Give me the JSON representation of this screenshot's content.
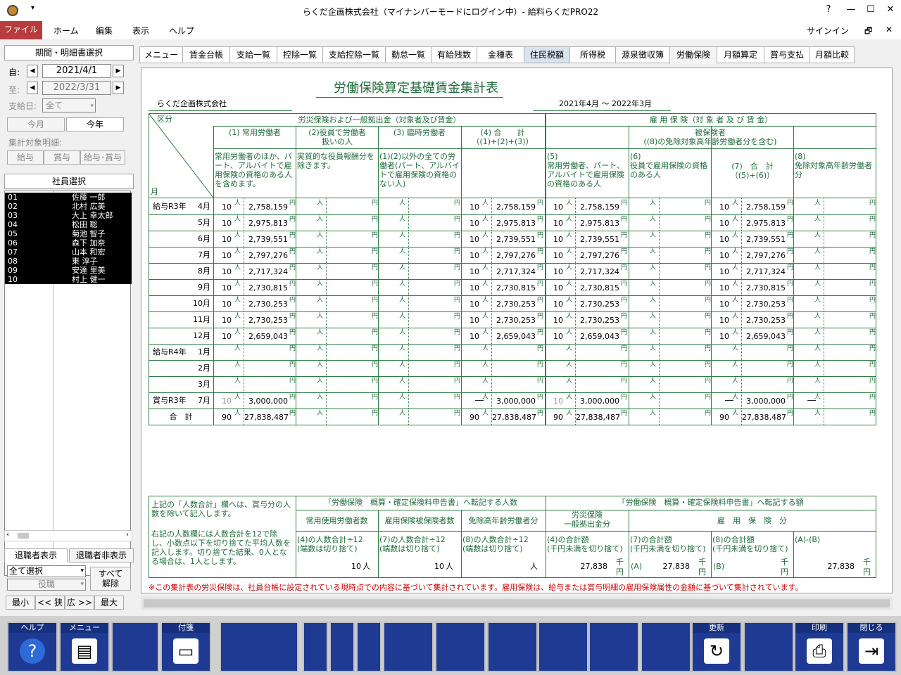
{
  "window": {
    "title": "らくだ企画株式会社（マイナンバーモードにログイン中）- 給料らくだPRO22",
    "signin": "サインイン"
  },
  "menu": [
    "ファイル",
    "ホーム",
    "編集",
    "表示",
    "ヘルプ"
  ],
  "left": {
    "header": "期間・明細書選択",
    "from_label": "自:",
    "from_date": "2021/4/1",
    "to_label": "至:",
    "to_date": "2022/3/31",
    "payday_label": "支給日:",
    "payday_value": "全て",
    "btn_thismonth": "今月",
    "btn_thisyear": "今年",
    "target_label": "集計対象明細:",
    "btn_salary": "給与",
    "btn_bonus": "賞与",
    "btn_both": "給与･賞与",
    "emp_header": "社員選択",
    "employees": [
      {
        "code": "01",
        "name": "佐藤 一郎"
      },
      {
        "code": "02",
        "name": "北村 広美"
      },
      {
        "code": "03",
        "name": "大上 幸太郎"
      },
      {
        "code": "04",
        "name": "松田 聡"
      },
      {
        "code": "05",
        "name": "菊池 智子"
      },
      {
        "code": "06",
        "name": "森下 加奈"
      },
      {
        "code": "07",
        "name": "山本 和宏"
      },
      {
        "code": "08",
        "name": "東 淳子"
      },
      {
        "code": "09",
        "name": "安達 里美"
      },
      {
        "code": "10",
        "name": "村上 健一"
      }
    ],
    "btn_show_retired": "退職者表示",
    "btn_hide_retired": "退職者非表示",
    "select_all": "全て選択",
    "position": "役職",
    "btn_release": "すべて\n解除",
    "btn_min": "最小",
    "btn_narrow": "<< 狭",
    "btn_wide": "広 >>",
    "btn_max": "最大"
  },
  "tabs": [
    "メニュー",
    "賃金台帳",
    "支給一覧",
    "控除一覧",
    "支給控除一覧",
    "勤怠一覧",
    "有給残数",
    "金種表",
    "住民税額",
    "所得税",
    "源泉徴収簿",
    "労働保険",
    "月額算定",
    "賞与支払",
    "月額比較"
  ],
  "active_tab": "労働保険",
  "doc": {
    "title": "労働保険算定基礎賃金集計表",
    "company": "らくだ企画株式会社",
    "period": "2021年4月 〜 2022年3月",
    "kubun": "区分",
    "tsuki": "月",
    "rousai_header": "労災保険および一般拠出金（対象者及び賃金）",
    "koyou_header": "雇 用 保 険（対 象 者 及 び 賃 金）",
    "hihoken_header": "被保険者\n((8)の免除対象高年齢労働者分を含む)",
    "cols": [
      "(1) 常用労働者",
      "(2)役員で労働者\n扱いの人",
      "(3) 臨時労働者",
      "(4) 合　　計\n（(1)+(2)+(3)）"
    ],
    "col_desc": [
      "常用労働者のほか、パート、アルバイトで雇用保険の資格のある人を含めます。",
      "実質的な役員報酬分を除きます。",
      "(1)(2)以外の全ての労働者(パート、アルバイトで雇用保険の資格のない人)",
      ""
    ],
    "kcols": [
      "(5)\n常用労働者、パート、アルバイトで雇用保険の資格のある人",
      "(6)\n役員で雇用保険の資格のある人",
      "(7)　合　計\n（(5)+(6)）",
      "(8)\n免除対象高年齢労働者分"
    ],
    "nin": "人",
    "en": "円",
    "dash": "―",
    "rows": [
      {
        "g": "給与R3年",
        "m": "4月",
        "c": "10",
        "v": "2,758,159"
      },
      {
        "g": "",
        "m": "5月",
        "c": "10",
        "v": "2,975,813"
      },
      {
        "g": "",
        "m": "6月",
        "c": "10",
        "v": "2,739,551"
      },
      {
        "g": "",
        "m": "7月",
        "c": "10",
        "v": "2,797,276"
      },
      {
        "g": "",
        "m": "8月",
        "c": "10",
        "v": "2,717,324"
      },
      {
        "g": "",
        "m": "9月",
        "c": "10",
        "v": "2,730,815"
      },
      {
        "g": "",
        "m": "10月",
        "c": "10",
        "v": "2,730,253"
      },
      {
        "g": "",
        "m": "11月",
        "c": "10",
        "v": "2,730,253"
      },
      {
        "g": "",
        "m": "12月",
        "c": "10",
        "v": "2,659,043"
      },
      {
        "g": "給与R4年",
        "m": "1月",
        "c": "",
        "v": ""
      },
      {
        "g": "",
        "m": "2月",
        "c": "",
        "v": ""
      },
      {
        "g": "",
        "m": "3月",
        "c": "",
        "v": ""
      },
      {
        "g": "賞与R3年",
        "m": "7月",
        "c": "10",
        "v": "3,000,000",
        "bonus": true
      },
      {
        "g": "合　計",
        "m": "",
        "c": "90",
        "v": "27,838,487",
        "total": true
      }
    ],
    "note1": "上記の「人数合計」欄へは、賞与分の人数を除いて記入します。",
    "note2": "右記の人数欄には人数合計を12で除し、小数点以下を切り捨てた平均人数を記入します。切り捨てた結果、0人となる場合は、1人とします。",
    "tr_nin": "「労働保険　概算・確定保険料申告書」へ転記する人数",
    "tr_gaku": "「労働保険　概算・確定保険料申告書」へ転記する額",
    "b_heads": [
      "常用使用労働者数",
      "雇用保険被保険者数",
      "免除高年齢労働者分",
      "労災保険\n一般拠出金分",
      "雇　用　保　険　分"
    ],
    "b_desc": [
      "(4)の人数合計÷12\n(端数は切り捨て)",
      "(7)の人数合計÷12\n(端数は切り捨て)",
      "(8)の人数合計÷12\n(端数は切り捨て)",
      "(4)の合計額\n(千円未満を切り捨て)",
      "(7)の合計額\n(千円未満を切り捨て)",
      "(8)の合計額\n(千円未満を切り捨て)",
      "(A)-(B)"
    ],
    "b_vals": [
      "10",
      "10",
      "",
      "27,838",
      "27,838",
      "",
      "27,838"
    ],
    "sen": "千",
    "A": "(A)",
    "B": "(B)",
    "footnote": "※この集計表の労災保険は、社員台帳に設定されている現時点での内容に基づいて集計されています。雇用保険は、給与または賞与明細の雇用保険属性の金額に基づいて集計されています。"
  },
  "fkeys": {
    "help": "ヘルプ",
    "menu": "メニュー",
    "fusen": "付箋",
    "update": "更新",
    "print": "印刷",
    "close": "閉じる"
  }
}
